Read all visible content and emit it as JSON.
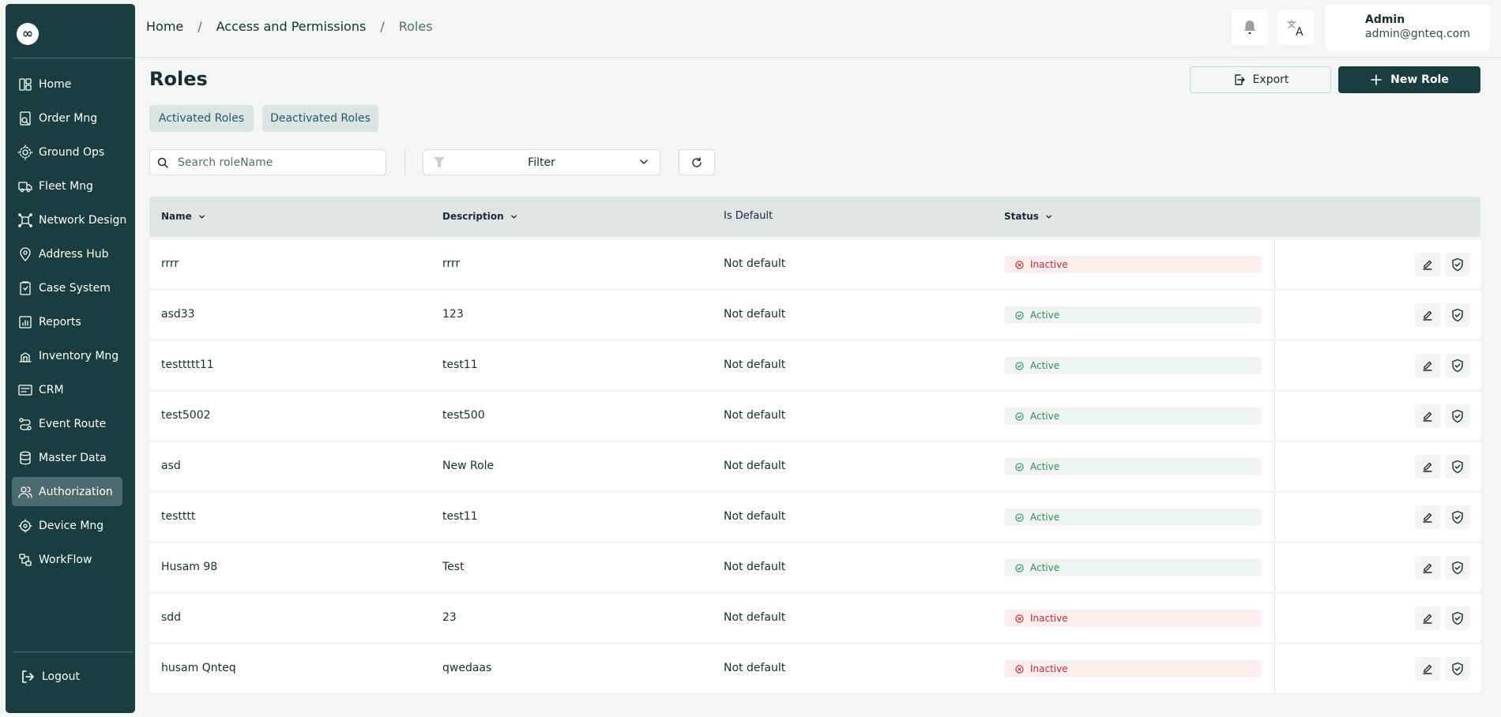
{
  "sidebar": {
    "logo": "∞",
    "items": [
      {
        "label": "Home",
        "icon": "dashboard-icon",
        "active": false
      },
      {
        "label": "Order Mng",
        "icon": "order-icon",
        "active": false
      },
      {
        "label": "Ground Ops",
        "icon": "ground-ops-icon",
        "active": false
      },
      {
        "label": "Fleet Mng",
        "icon": "truck-icon",
        "active": false
      },
      {
        "label": "Network Design",
        "icon": "network-icon",
        "active": false
      },
      {
        "label": "Address Hub",
        "icon": "location-icon",
        "active": false
      },
      {
        "label": "Case System",
        "icon": "case-icon",
        "active": false
      },
      {
        "label": "Reports",
        "icon": "reports-icon",
        "active": false
      },
      {
        "label": "Inventory Mng",
        "icon": "inventory-icon",
        "active": false
      },
      {
        "label": "CRM",
        "icon": "crm-icon",
        "active": false
      },
      {
        "label": "Event Route",
        "icon": "route-icon",
        "active": false
      },
      {
        "label": "Master Data",
        "icon": "database-icon",
        "active": false
      },
      {
        "label": "Authorization",
        "icon": "users-icon",
        "active": true
      },
      {
        "label": "Device Mng",
        "icon": "device-icon",
        "active": false
      },
      {
        "label": "WorkFlow",
        "icon": "workflow-icon",
        "active": false
      }
    ],
    "logout_label": "Logout"
  },
  "breadcrumb": [
    "Home",
    "Access and Permissions",
    "Roles"
  ],
  "breadcrumb_separator": "/",
  "user": {
    "name": "Admin",
    "email": "admin@gnteq.com"
  },
  "page": {
    "title": "Roles",
    "export_label": "Export",
    "new_label": "New Role",
    "tabs": [
      "Activated Roles",
      "Deactivated Roles"
    ],
    "search_placeholder": "Search roleName",
    "filter_label": "Filter"
  },
  "table": {
    "headers": [
      "Name",
      "Description",
      "Is Default",
      "Status"
    ],
    "rows": [
      {
        "name": "rrrr",
        "description": "rrrr",
        "is_default": "Not default",
        "status": "Inactive"
      },
      {
        "name": "asd33",
        "description": "123",
        "is_default": "Not default",
        "status": "Active"
      },
      {
        "name": "testtttt11",
        "description": "test11",
        "is_default": "Not default",
        "status": "Active"
      },
      {
        "name": "test5002",
        "description": "test500",
        "is_default": "Not default",
        "status": "Active"
      },
      {
        "name": "asd",
        "description": "New Role",
        "is_default": "Not default",
        "status": "Active"
      },
      {
        "name": "testttt",
        "description": "test11",
        "is_default": "Not default",
        "status": "Active"
      },
      {
        "name": "Husam 98",
        "description": "Test",
        "is_default": "Not default",
        "status": "Active"
      },
      {
        "name": "sdd",
        "description": "23",
        "is_default": "Not default",
        "status": "Inactive"
      },
      {
        "name": "husam Qnteq",
        "description": "qwedaas",
        "is_default": "Not default",
        "status": "Inactive"
      }
    ]
  },
  "colors": {
    "sidebar_bg": "#1a3d40",
    "primary": "#1a3d40",
    "tab_text": "#1d5d66",
    "active_text": "#2f8a55",
    "inactive_text": "#c5263c"
  }
}
